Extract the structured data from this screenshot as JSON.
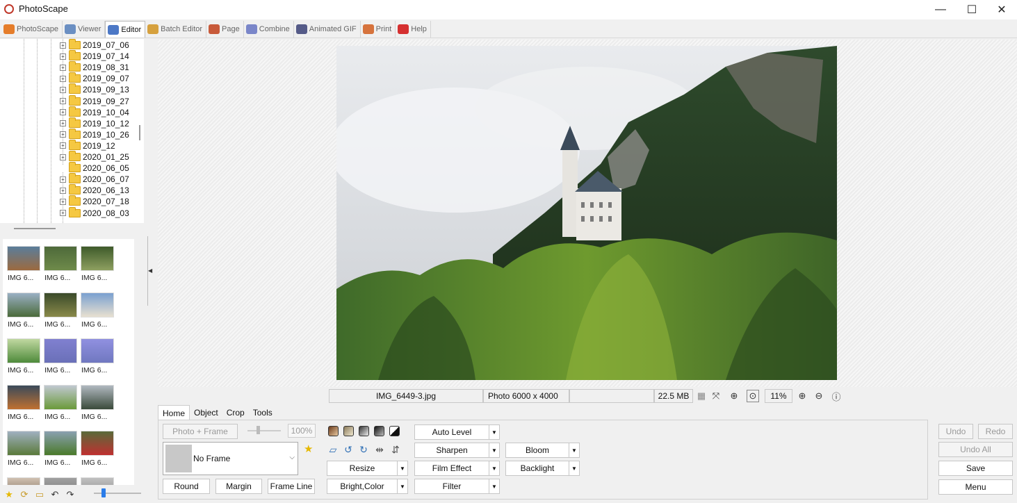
{
  "window": {
    "title": "PhotoScape",
    "controls": [
      "—",
      "☐",
      "✕"
    ]
  },
  "tabs": [
    {
      "label": "PhotoScape",
      "color": "#e57d2b"
    },
    {
      "label": "Viewer",
      "color": "#6b8fc2"
    },
    {
      "label": "Editor",
      "color": "#4c78c6",
      "active": true
    },
    {
      "label": "Batch Editor",
      "color": "#d6a13e"
    },
    {
      "label": "Page",
      "color": "#c85a3a"
    },
    {
      "label": "Combine",
      "color": "#7a86c9"
    },
    {
      "label": "Animated GIF",
      "color": "#555b88"
    },
    {
      "label": "Print",
      "color": "#d6733d"
    },
    {
      "label": "Help",
      "color": "#d53030"
    }
  ],
  "folders": [
    {
      "name": "2019_07_06",
      "expandable": true
    },
    {
      "name": "2019_07_14",
      "expandable": true
    },
    {
      "name": "2019_08_31",
      "expandable": true
    },
    {
      "name": "2019_09_07",
      "expandable": true
    },
    {
      "name": "2019_09_13",
      "expandable": true
    },
    {
      "name": "2019_09_27",
      "expandable": true
    },
    {
      "name": "2019_10_04",
      "expandable": true
    },
    {
      "name": "2019_10_12",
      "expandable": true
    },
    {
      "name": "2019_10_26",
      "expandable": true
    },
    {
      "name": "2019_12",
      "expandable": true
    },
    {
      "name": "2020_01_25",
      "expandable": true
    },
    {
      "name": "2020_06_05",
      "expandable": false
    },
    {
      "name": "2020_06_07",
      "expandable": true
    },
    {
      "name": "2020_06_13",
      "expandable": true
    },
    {
      "name": "2020_07_18",
      "expandable": true
    },
    {
      "name": "2020_08_03",
      "expandable": true
    }
  ],
  "thumbnails": [
    {
      "caption": "IMG 6...",
      "colors": [
        "#5a7d9a",
        "#9c6a3f"
      ]
    },
    {
      "caption": "IMG 6...",
      "colors": [
        "#4e6a3a",
        "#6e8a4a"
      ]
    },
    {
      "caption": "IMG 6...",
      "colors": [
        "#3e5a2a",
        "#8ea060"
      ]
    },
    {
      "caption": "IMG 6...",
      "colors": [
        "#9ab0c4",
        "#4a6a3a"
      ]
    },
    {
      "caption": "IMG 6...",
      "colors": [
        "#3a4a2a",
        "#8a8a4a"
      ]
    },
    {
      "caption": "IMG 6...",
      "colors": [
        "#7aa0d0",
        "#e8e0d0"
      ]
    },
    {
      "caption": "IMG 6...",
      "colors": [
        "#c0d8a0",
        "#4e8a3a"
      ]
    },
    {
      "caption": "IMG 6...",
      "colors": [
        "#8080d0",
        "#6a70b8"
      ]
    },
    {
      "caption": "IMG 6...",
      "colors": [
        "#9090e0",
        "#7078c0"
      ]
    },
    {
      "caption": "IMG 6...",
      "colors": [
        "#3a4a5a",
        "#c07030"
      ]
    },
    {
      "caption": "IMG 6...",
      "colors": [
        "#c0c8d0",
        "#6a9a3a"
      ]
    },
    {
      "caption": "IMG 6...",
      "colors": [
        "#b0b8c0",
        "#3a4a3a"
      ]
    },
    {
      "caption": "IMG 6...",
      "colors": [
        "#a0b0c0",
        "#5a7a3a"
      ]
    },
    {
      "caption": "IMG 6...",
      "colors": [
        "#8aa0b0",
        "#4a7a2a"
      ]
    },
    {
      "caption": "IMG 6...",
      "colors": [
        "#5a6a3a",
        "#c03030"
      ]
    },
    {
      "caption": "",
      "colors": [
        "#d0c0b0",
        "#6a5a4a"
      ]
    },
    {
      "caption": "",
      "colors": [
        "#a0a0a0",
        "#707070"
      ]
    },
    {
      "caption": "",
      "colors": [
        "#c0c0c0",
        "#808080"
      ]
    }
  ],
  "status": {
    "filename": "IMG_6449-3.jpg",
    "dimensions": "Photo 6000 x 4000",
    "filesize": "22.5 MB",
    "zoom": "11%"
  },
  "editor_tabs": [
    {
      "label": "Home",
      "active": true
    },
    {
      "label": "Object"
    },
    {
      "label": "Crop"
    },
    {
      "label": "Tools"
    }
  ],
  "home": {
    "photo_frame": "Photo + Frame",
    "opacity": "100%",
    "frame_name": "No Frame",
    "round": "Round",
    "margin": "Margin",
    "frame_line": "Frame Line",
    "resize": "Resize",
    "bright_color": "Bright,Color",
    "auto_level": "Auto Level",
    "sharpen": "Sharpen",
    "film_effect": "Film Effect",
    "filter": "Filter",
    "bloom": "Bloom",
    "backlight": "Backlight"
  },
  "actions": {
    "undo": "Undo",
    "redo": "Redo",
    "undo_all": "Undo All",
    "save": "Save",
    "menu": "Menu"
  }
}
